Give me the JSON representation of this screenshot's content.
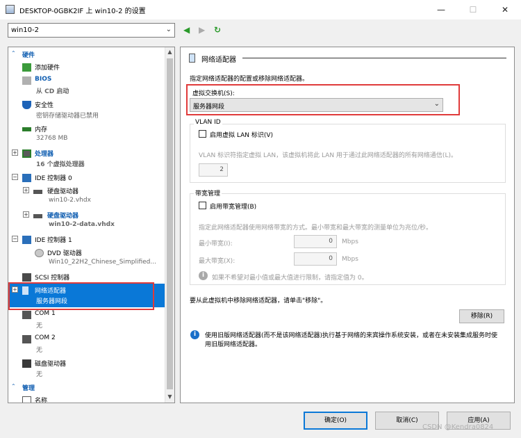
{
  "window": {
    "title": "DESKTOP-0GBK2IF 上 win10-2 的设置",
    "minimize": "—",
    "maximize": "☐",
    "close": "✕"
  },
  "vm_selector": {
    "value": "win10-2"
  },
  "nav": {
    "back": "◀",
    "forward": "▶",
    "refresh": "↻"
  },
  "tree": {
    "hardware_section": "硬件",
    "manage_section": "管理",
    "items": [
      {
        "name": "添加硬件",
        "sub": ""
      },
      {
        "name": "BIOS",
        "sub": "从 CD 启动"
      },
      {
        "name": "安全性",
        "sub": "密钥存储驱动器已禁用"
      },
      {
        "name": "内存",
        "sub": "32768 MB"
      },
      {
        "name": "处理器",
        "sub": "16 个虚拟处理器"
      },
      {
        "name": "IDE 控制器 0",
        "sub": ""
      },
      {
        "name": "硬盘驱动器",
        "sub": "win10-2.vhdx"
      },
      {
        "name": "硬盘驱动器",
        "sub": "win10-2-data.vhdx"
      },
      {
        "name": "IDE 控制器 1",
        "sub": ""
      },
      {
        "name": "DVD 驱动器",
        "sub": "Win10_22H2_Chinese_Simplified..."
      },
      {
        "name": "SCSI 控制器",
        "sub": ""
      },
      {
        "name": "网络适配器",
        "sub": "服务器网段"
      },
      {
        "name": "COM 1",
        "sub": "无"
      },
      {
        "name": "COM 2",
        "sub": "无"
      },
      {
        "name": "磁盘驱动器",
        "sub": "无"
      },
      {
        "name": "名称",
        "sub": ""
      }
    ]
  },
  "panel": {
    "title": "网络适配器",
    "description": "指定网络适配器的配置或移除网络适配器。",
    "switch_label": "虚拟交换机(S):",
    "switch_value": "服务器网段",
    "vlan": {
      "group_label": "VLAN ID",
      "checkbox_label": "启用虚拟 LAN 标识(V)",
      "description": "VLAN 标识符指定虚拟 LAN，该虚拟机将此 LAN 用于通过此网络适配器的所有网络通信(L)。",
      "value": "2"
    },
    "bandwidth": {
      "group_label": "带宽管理",
      "checkbox_label": "启用带宽管理(B)",
      "description": "指定此网络适配器使用网络带宽的方式。最小带宽和最大带宽的测量单位为兆位/秒。",
      "min_label": "最小带宽(I):",
      "min_value": "0",
      "max_label": "最大带宽(X):",
      "max_value": "0",
      "unit": "Mbps",
      "hint": "如果不希望对最小值或最大值进行限制，请指定值为 0。"
    },
    "remove_hint": "要从此虚拟机中移除网络适配器，请单击\"移除\"。",
    "remove_button": "移除(R)",
    "legacy_info": "使用旧版网络适配器(而不是该网络适配器)执行基于网络的来宾操作系统安装，或者在未安装集成服务时使用旧版网络适配器。"
  },
  "footer": {
    "ok": "确定(O)",
    "cancel": "取消(C)",
    "apply": "应用(A)",
    "watermark": "CSDN @Kendra0824"
  },
  "colors": {
    "accent": "#0a78d7",
    "highlight": "#e03a3a",
    "link": "#0d5cb0"
  }
}
